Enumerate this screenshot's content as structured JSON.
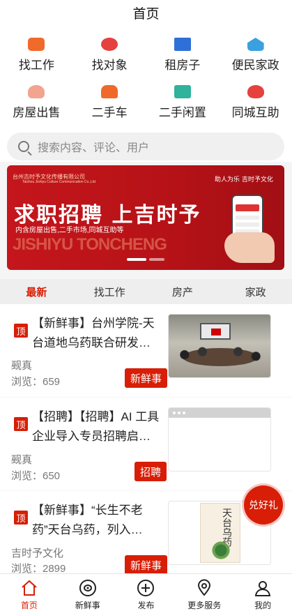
{
  "header": {
    "title": "首页"
  },
  "grid": [
    {
      "label": "找工作",
      "icon": "briefcase-icon",
      "color": "#f06a2b"
    },
    {
      "label": "找对象",
      "icon": "heart-icon",
      "color": "#e5413e"
    },
    {
      "label": "租房子",
      "icon": "building-icon",
      "color": "#2f6fd8"
    },
    {
      "label": "便民家政",
      "icon": "home-service-icon",
      "color": "#3aa0e0"
    },
    {
      "label": "房屋出售",
      "icon": "house-hand-icon",
      "color": "#f2a48e"
    },
    {
      "label": "二手车",
      "icon": "car-icon",
      "color": "#ef6a2a"
    },
    {
      "label": "二手闲置",
      "icon": "box-icon",
      "color": "#2fb39b"
    },
    {
      "label": "同城互助",
      "icon": "handshake-icon",
      "color": "#e5413e"
    }
  ],
  "search": {
    "placeholder": "搜索内容、评论、用户"
  },
  "banner": {
    "company": "台州吉时予文化传播有限公司",
    "company_en": "Taizhou Jishiyu Culture Communication Co.,Ltd",
    "slogan": "助人为乐  吉时予文化",
    "headline": "求职招聘  上吉时予",
    "sub": "内含房屋出售,二手市场,同城互助等",
    "big_en": "JISHIYU TONCHENG"
  },
  "tabs": [
    {
      "label": "最新",
      "active": true
    },
    {
      "label": "找工作",
      "active": false
    },
    {
      "label": "房产",
      "active": false
    },
    {
      "label": "家政",
      "active": false
    }
  ],
  "feed": [
    {
      "badge": "顶",
      "title": "【新鲜事】台州学院-天台道地乌药联合研发…",
      "author": "觋真",
      "views": "浏览：659",
      "category": "新鲜事",
      "thumb": "meeting"
    },
    {
      "badge": "顶",
      "title": "【招聘】【招聘】AI 工具企业导入专员招聘启…",
      "author": "觋真",
      "views": "浏览：650",
      "category": "招聘",
      "thumb": "placeholder"
    },
    {
      "badge": "顶",
      "title": "【新鲜事】“长生不老药”天台乌药，列入…",
      "author": "吉时予文化",
      "views": "浏览：2899",
      "category": "新鲜事",
      "thumb": "book",
      "thumb_text": "天台乌药"
    }
  ],
  "float_button": {
    "label": "兑好礼"
  },
  "tabbar": [
    {
      "label": "首页",
      "icon": "home-icon",
      "active": true
    },
    {
      "label": "新鲜事",
      "icon": "eye-icon",
      "active": false
    },
    {
      "label": "发布",
      "icon": "plus-circle-icon",
      "active": false
    },
    {
      "label": "更多服务",
      "icon": "location-pin-icon",
      "active": false
    },
    {
      "label": "我的",
      "icon": "user-icon",
      "active": false
    }
  ],
  "colors": {
    "accent": "#d81e06",
    "background": "#f5f5f5"
  }
}
